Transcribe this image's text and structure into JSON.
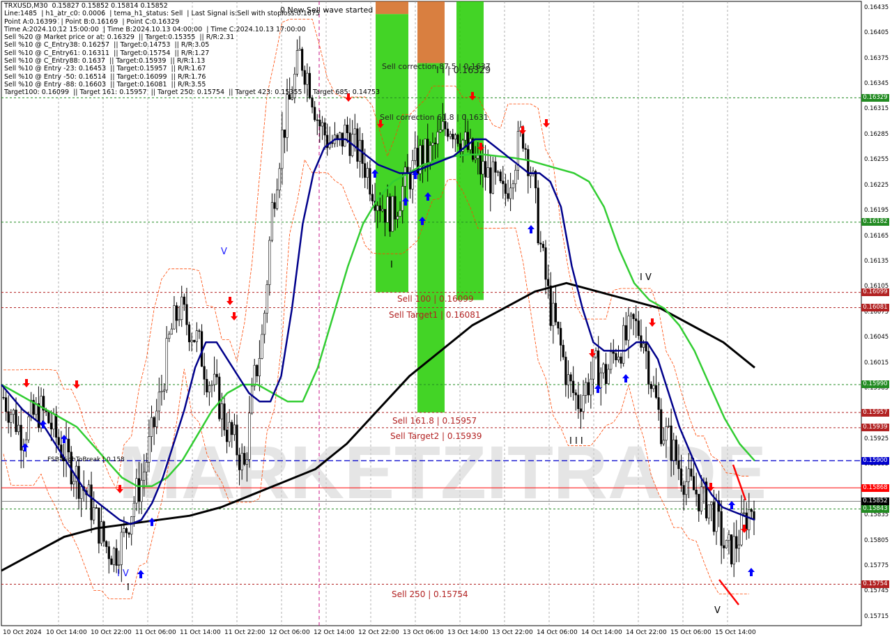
{
  "info_lines": [
    "TRXUSD,M30  0.15827 0.15852 0.15814 0.15852",
    "Line:1485  | h1_atr_c0: 0.0006  | tema_h1_status: Sell  | Last Signal is:Sell with stoploss:0.1675",
    "Point A:0.16399  | Point B:0.16169  | Point C:0.16329",
    "Time A:2024.10.12 15:00:00  | Time B:2024.10.13 04:00:00  | Time C:2024.10.13 17:00:00",
    "Sell %20 @ Market price or at: 0.16329  || Target:0.15355  || R/R:2.31",
    "Sell %10 @ C_Entry38: 0.16257  || Target:0.14753  || R/R:3.05",
    "Sell %10 @ C_Entry61: 0.16311  || Target:0.15754  || R/R:1.27",
    "Sell %10 @ C_Entry88: 0.1637  || Target:0.15939  || R/R:1.13",
    "Sell %10 @ Entry -23: 0.16453  || Target:0.15957  || R/R:1.67",
    "Sell %10 @ Entry -50: 0.16514  || Target:0.16099  || R/R:1.76",
    "Sell %10 @ Entry -88: 0.16603  || Target:0.16081  || R/R:3.55",
    "Target100: 0.16099  || Target 161: 0.15957  || Target 250: 0.15754  || Target 423: 0.15355  || Target 685: 0.14753"
  ],
  "top_note": "0 New Sell wave started",
  "annotations": {
    "sell_correction_875": "Sell correction 87.5 | 0.1637",
    "sell_correction_618": "Sell correction 61.8 | 0.1631",
    "point_c_label": "I I | 0.16329",
    "sell_100": "Sell 100 | 0.16099",
    "sell_target1": "Sell Target1 | 0.16081",
    "sell_1618": "Sell 161.8 | 0.15957",
    "sell_target2": "Sell Target2 | 0.15939",
    "sell_250": "Sell 250 | 0.15754",
    "fsb": "FSB-HighToBreak | 0.158"
  },
  "wave_labels": {
    "w_v_top": "V",
    "w_iv_left": "I V",
    "w_i_left": "I",
    "w_i_mid": "I",
    "w_iii": "I I I",
    "w_iv_right": "I V",
    "w_v_bottom": "V"
  },
  "watermark": "MARKETZITRADE",
  "colors": {
    "background": "#ffffff",
    "grid": "#9e9e9e",
    "candle": "#000000",
    "ema_fast": "#00008b",
    "ema_mid": "#32cd32",
    "ema_slow": "#000000",
    "envelope": "#ff4500",
    "green_zone": "#22cc00",
    "orange_zone": "#d2691e",
    "level_green": "#228b22",
    "level_red": "#b22222",
    "level_blue": "#0000cd",
    "level_solid_red": "#ff0000",
    "level_gray": "#808080",
    "arrow_up": "#0000ff",
    "arrow_down": "#ff0000"
  },
  "price_tags": [
    {
      "label": "0.16329",
      "value": 0.16329,
      "color": "#228b22"
    },
    {
      "label": "0.16182",
      "value": 0.16182,
      "color": "#228b22"
    },
    {
      "label": "0.16099",
      "value": 0.16099,
      "color": "#b22222"
    },
    {
      "label": "0.16081",
      "value": 0.16081,
      "color": "#b22222"
    },
    {
      "label": "0.15990",
      "value": 0.1599,
      "color": "#228b22"
    },
    {
      "label": "0.15957",
      "value": 0.15957,
      "color": "#b22222"
    },
    {
      "label": "0.15939",
      "value": 0.15939,
      "color": "#b22222"
    },
    {
      "label": "0.15900",
      "value": 0.159,
      "color": "#0000cd"
    },
    {
      "label": "0.15868",
      "value": 0.15868,
      "color": "#ff0000"
    },
    {
      "label": "0.15852",
      "value": 0.15852,
      "color": "#000000"
    },
    {
      "label": "0.15843",
      "value": 0.15843,
      "color": "#228b22"
    },
    {
      "label": "0.15754",
      "value": 0.15754,
      "color": "#b22222"
    }
  ],
  "chart_data": {
    "type": "candlestick",
    "symbol": "TRXUSD",
    "timeframe": "M30",
    "last": {
      "open": 0.15827,
      "high": 0.15852,
      "low": 0.15814,
      "close": 0.15852
    },
    "ylim": [
      0.15705,
      0.16443
    ],
    "y_ticks": [
      "0.16435",
      "0.16405",
      "0.16375",
      "0.16345",
      "0.16315",
      "0.16285",
      "0.16255",
      "0.16225",
      "0.16195",
      "0.16165",
      "0.16135",
      "0.16105",
      "0.16075",
      "0.16045",
      "0.16015",
      "0.15985",
      "0.15955",
      "0.15925",
      "0.15895",
      "0.15865",
      "0.15835",
      "0.15805",
      "0.15775",
      "0.15745",
      "0.15715"
    ],
    "x_ticks": [
      "10 Oct 2024",
      "10 Oct 14:00",
      "10 Oct 22:00",
      "11 Oct 06:00",
      "11 Oct 14:00",
      "11 Oct 22:00",
      "12 Oct 06:00",
      "12 Oct 14:00",
      "12 Oct 22:00",
      "13 Oct 06:00",
      "13 Oct 14:00",
      "13 Oct 22:00",
      "14 Oct 06:00",
      "14 Oct 14:00",
      "14 Oct 22:00",
      "15 Oct 06:00",
      "15 Oct 14:00"
    ],
    "close_path": [
      0.15975,
      0.15955,
      0.1593,
      0.1595,
      0.1596,
      0.15945,
      0.1592,
      0.159,
      0.1588,
      0.1586,
      0.1583,
      0.158,
      0.1579,
      0.1581,
      0.1585,
      0.1588,
      0.1593,
      0.1598,
      0.1605,
      0.1608,
      0.1606,
      0.1604,
      0.16,
      0.1598,
      0.1594,
      0.1592,
      0.1589,
      0.1599,
      0.1605,
      0.162,
      0.1628,
      0.1633,
      0.1638,
      0.1635,
      0.163,
      0.1628,
      0.1627,
      0.1629,
      0.1627,
      0.1625,
      0.1622,
      0.162,
      0.1619,
      0.1622,
      0.1624,
      0.1626,
      0.1626,
      0.1628,
      0.163,
      0.1629,
      0.1627,
      0.1625,
      0.1624,
      0.1623,
      0.1621,
      0.1625,
      0.1629,
      0.1624,
      0.1615,
      0.1608,
      0.1604,
      0.1599,
      0.1597,
      0.1599,
      0.1601,
      0.16,
      0.1603,
      0.1604,
      0.1606,
      0.1605,
      0.1599,
      0.1594,
      0.1592,
      0.1589,
      0.1587,
      0.1586,
      0.1585,
      0.1583,
      0.1579,
      0.158,
      0.1583,
      0.15852
    ],
    "ema_fast": [
      0.1599,
      0.15975,
      0.1596,
      0.1595,
      0.1594,
      0.1592,
      0.159,
      0.1588,
      0.1586,
      0.1585,
      0.1584,
      0.1583,
      0.15825,
      0.1583,
      0.1585,
      0.1588,
      0.1592,
      0.1596,
      0.1601,
      0.1604,
      0.1604,
      0.1602,
      0.16,
      0.1598,
      0.1597,
      0.1597,
      0.16,
      0.1608,
      0.1618,
      0.1624,
      0.1627,
      0.1628,
      0.1628,
      0.1627,
      0.1626,
      0.1625,
      0.16245,
      0.1624,
      0.1624,
      0.16245,
      0.1625,
      0.16255,
      0.1626,
      0.1627,
      0.1628,
      0.1628,
      0.1627,
      0.1626,
      0.1625,
      0.1624,
      0.1624,
      0.1623,
      0.162,
      0.1613,
      0.1608,
      0.1604,
      0.1603,
      0.1603,
      0.1603,
      0.1604,
      0.1604,
      0.1602,
      0.1598,
      0.1594,
      0.1591,
      0.1588,
      0.1586,
      0.15845,
      0.1584,
      0.15835,
      0.1583
    ],
    "ema_mid": [
      0.1599,
      0.1598,
      0.1597,
      0.1596,
      0.1595,
      0.1594,
      0.1592,
      0.159,
      0.1588,
      0.1587,
      0.1587,
      0.1588,
      0.159,
      0.1593,
      0.1596,
      0.1598,
      0.1599,
      0.1599,
      0.1598,
      0.1597,
      0.1597,
      0.1601,
      0.1607,
      0.1613,
      0.1618,
      0.1621,
      0.1623,
      0.1624,
      0.1625,
      0.16255,
      0.1626,
      0.16262,
      0.16262,
      0.1626,
      0.16258,
      0.16255,
      0.1625,
      0.16245,
      0.1624,
      0.1623,
      0.162,
      0.1615,
      0.1611,
      0.1609,
      0.1608,
      0.1606,
      0.1603,
      0.1599,
      0.1595,
      0.1592,
      0.159
    ],
    "ema_slow": [
      0.1577,
      0.1579,
      0.1581,
      0.1582,
      0.15825,
      0.1583,
      0.15835,
      0.15845,
      0.1586,
      0.15875,
      0.1589,
      0.1592,
      0.1596,
      0.16,
      0.1603,
      0.1606,
      0.1608,
      0.161,
      0.1611,
      0.161,
      0.1609,
      0.1608,
      0.1606,
      0.1604,
      0.1601
    ]
  }
}
